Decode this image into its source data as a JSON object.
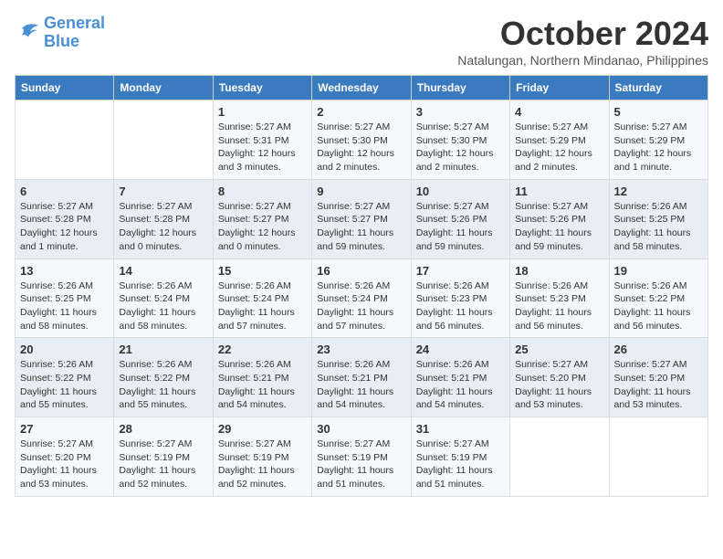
{
  "logo": {
    "line1": "General",
    "line2": "Blue"
  },
  "title": "October 2024",
  "subtitle": "Natalungan, Northern Mindanao, Philippines",
  "days_of_week": [
    "Sunday",
    "Monday",
    "Tuesday",
    "Wednesday",
    "Thursday",
    "Friday",
    "Saturday"
  ],
  "weeks": [
    [
      {
        "day": "",
        "detail": ""
      },
      {
        "day": "",
        "detail": ""
      },
      {
        "day": "1",
        "detail": "Sunrise: 5:27 AM\nSunset: 5:31 PM\nDaylight: 12 hours\nand 3 minutes."
      },
      {
        "day": "2",
        "detail": "Sunrise: 5:27 AM\nSunset: 5:30 PM\nDaylight: 12 hours\nand 2 minutes."
      },
      {
        "day": "3",
        "detail": "Sunrise: 5:27 AM\nSunset: 5:30 PM\nDaylight: 12 hours\nand 2 minutes."
      },
      {
        "day": "4",
        "detail": "Sunrise: 5:27 AM\nSunset: 5:29 PM\nDaylight: 12 hours\nand 2 minutes."
      },
      {
        "day": "5",
        "detail": "Sunrise: 5:27 AM\nSunset: 5:29 PM\nDaylight: 12 hours\nand 1 minute."
      }
    ],
    [
      {
        "day": "6",
        "detail": "Sunrise: 5:27 AM\nSunset: 5:28 PM\nDaylight: 12 hours\nand 1 minute."
      },
      {
        "day": "7",
        "detail": "Sunrise: 5:27 AM\nSunset: 5:28 PM\nDaylight: 12 hours\nand 0 minutes."
      },
      {
        "day": "8",
        "detail": "Sunrise: 5:27 AM\nSunset: 5:27 PM\nDaylight: 12 hours\nand 0 minutes."
      },
      {
        "day": "9",
        "detail": "Sunrise: 5:27 AM\nSunset: 5:27 PM\nDaylight: 11 hours\nand 59 minutes."
      },
      {
        "day": "10",
        "detail": "Sunrise: 5:27 AM\nSunset: 5:26 PM\nDaylight: 11 hours\nand 59 minutes."
      },
      {
        "day": "11",
        "detail": "Sunrise: 5:27 AM\nSunset: 5:26 PM\nDaylight: 11 hours\nand 59 minutes."
      },
      {
        "day": "12",
        "detail": "Sunrise: 5:26 AM\nSunset: 5:25 PM\nDaylight: 11 hours\nand 58 minutes."
      }
    ],
    [
      {
        "day": "13",
        "detail": "Sunrise: 5:26 AM\nSunset: 5:25 PM\nDaylight: 11 hours\nand 58 minutes."
      },
      {
        "day": "14",
        "detail": "Sunrise: 5:26 AM\nSunset: 5:24 PM\nDaylight: 11 hours\nand 58 minutes."
      },
      {
        "day": "15",
        "detail": "Sunrise: 5:26 AM\nSunset: 5:24 PM\nDaylight: 11 hours\nand 57 minutes."
      },
      {
        "day": "16",
        "detail": "Sunrise: 5:26 AM\nSunset: 5:24 PM\nDaylight: 11 hours\nand 57 minutes."
      },
      {
        "day": "17",
        "detail": "Sunrise: 5:26 AM\nSunset: 5:23 PM\nDaylight: 11 hours\nand 56 minutes."
      },
      {
        "day": "18",
        "detail": "Sunrise: 5:26 AM\nSunset: 5:23 PM\nDaylight: 11 hours\nand 56 minutes."
      },
      {
        "day": "19",
        "detail": "Sunrise: 5:26 AM\nSunset: 5:22 PM\nDaylight: 11 hours\nand 56 minutes."
      }
    ],
    [
      {
        "day": "20",
        "detail": "Sunrise: 5:26 AM\nSunset: 5:22 PM\nDaylight: 11 hours\nand 55 minutes."
      },
      {
        "day": "21",
        "detail": "Sunrise: 5:26 AM\nSunset: 5:22 PM\nDaylight: 11 hours\nand 55 minutes."
      },
      {
        "day": "22",
        "detail": "Sunrise: 5:26 AM\nSunset: 5:21 PM\nDaylight: 11 hours\nand 54 minutes."
      },
      {
        "day": "23",
        "detail": "Sunrise: 5:26 AM\nSunset: 5:21 PM\nDaylight: 11 hours\nand 54 minutes."
      },
      {
        "day": "24",
        "detail": "Sunrise: 5:26 AM\nSunset: 5:21 PM\nDaylight: 11 hours\nand 54 minutes."
      },
      {
        "day": "25",
        "detail": "Sunrise: 5:27 AM\nSunset: 5:20 PM\nDaylight: 11 hours\nand 53 minutes."
      },
      {
        "day": "26",
        "detail": "Sunrise: 5:27 AM\nSunset: 5:20 PM\nDaylight: 11 hours\nand 53 minutes."
      }
    ],
    [
      {
        "day": "27",
        "detail": "Sunrise: 5:27 AM\nSunset: 5:20 PM\nDaylight: 11 hours\nand 53 minutes."
      },
      {
        "day": "28",
        "detail": "Sunrise: 5:27 AM\nSunset: 5:19 PM\nDaylight: 11 hours\nand 52 minutes."
      },
      {
        "day": "29",
        "detail": "Sunrise: 5:27 AM\nSunset: 5:19 PM\nDaylight: 11 hours\nand 52 minutes."
      },
      {
        "day": "30",
        "detail": "Sunrise: 5:27 AM\nSunset: 5:19 PM\nDaylight: 11 hours\nand 51 minutes."
      },
      {
        "day": "31",
        "detail": "Sunrise: 5:27 AM\nSunset: 5:19 PM\nDaylight: 11 hours\nand 51 minutes."
      },
      {
        "day": "",
        "detail": ""
      },
      {
        "day": "",
        "detail": ""
      }
    ]
  ]
}
